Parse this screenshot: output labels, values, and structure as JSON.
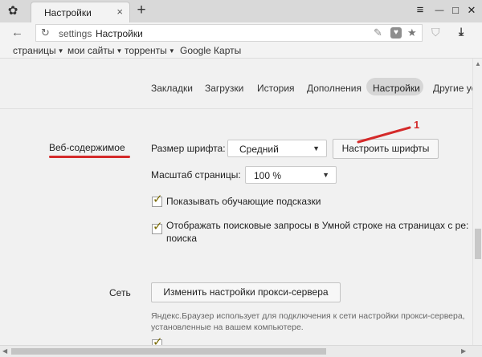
{
  "tab": {
    "title": "Настройки",
    "close": "×"
  },
  "new_tab": "+",
  "window_controls": {
    "menu": "≡",
    "minimize": "—",
    "maximize": "□",
    "close": "✕"
  },
  "address": {
    "scheme": "settings",
    "title": "Настройки"
  },
  "bookmarks": [
    {
      "label": "страницы",
      "has_menu": true
    },
    {
      "label": "мои сайты",
      "has_menu": true
    },
    {
      "label": "торренты",
      "has_menu": true
    },
    {
      "label": "Google Карты",
      "has_menu": false
    }
  ],
  "subnav": {
    "items": [
      "Закладки",
      "Загрузки",
      "История",
      "Дополнения",
      "Настройки",
      "Другие устро"
    ],
    "active": "Настройки"
  },
  "web_content": {
    "section": "Веб-содержимое",
    "font_size_label": "Размер шрифта:",
    "font_size_value": "Средний",
    "customize_fonts_button": "Настроить шрифты",
    "page_zoom_label": "Масштаб страницы:",
    "page_zoom_value": "100 %",
    "show_hints_label": "Показывать обучающие подсказки",
    "show_hints_checked": true,
    "show_queries_label_line1": "Отображать поисковые запросы в Умной строке на страницах с ре:",
    "show_queries_label_line2": "поиска",
    "show_queries_checked": true
  },
  "network": {
    "section": "Сеть",
    "proxy_button": "Изменить настройки прокси-сервера",
    "hint_line1": "Яндекс.Браузер использует для подключения к сети настройки прокси-сервера,",
    "hint_line2": "установленные на вашем компьютере."
  },
  "annotation": {
    "number": "1",
    "color": "#d42a2a"
  },
  "icons": {
    "tab": "gear-icon",
    "back": "arrow-left-icon",
    "reload": "reload-icon",
    "omnibox": [
      "pen-icon",
      "shield-badge-icon",
      "star-icon"
    ],
    "toolbar": [
      "shield-icon",
      "download-icon"
    ]
  }
}
